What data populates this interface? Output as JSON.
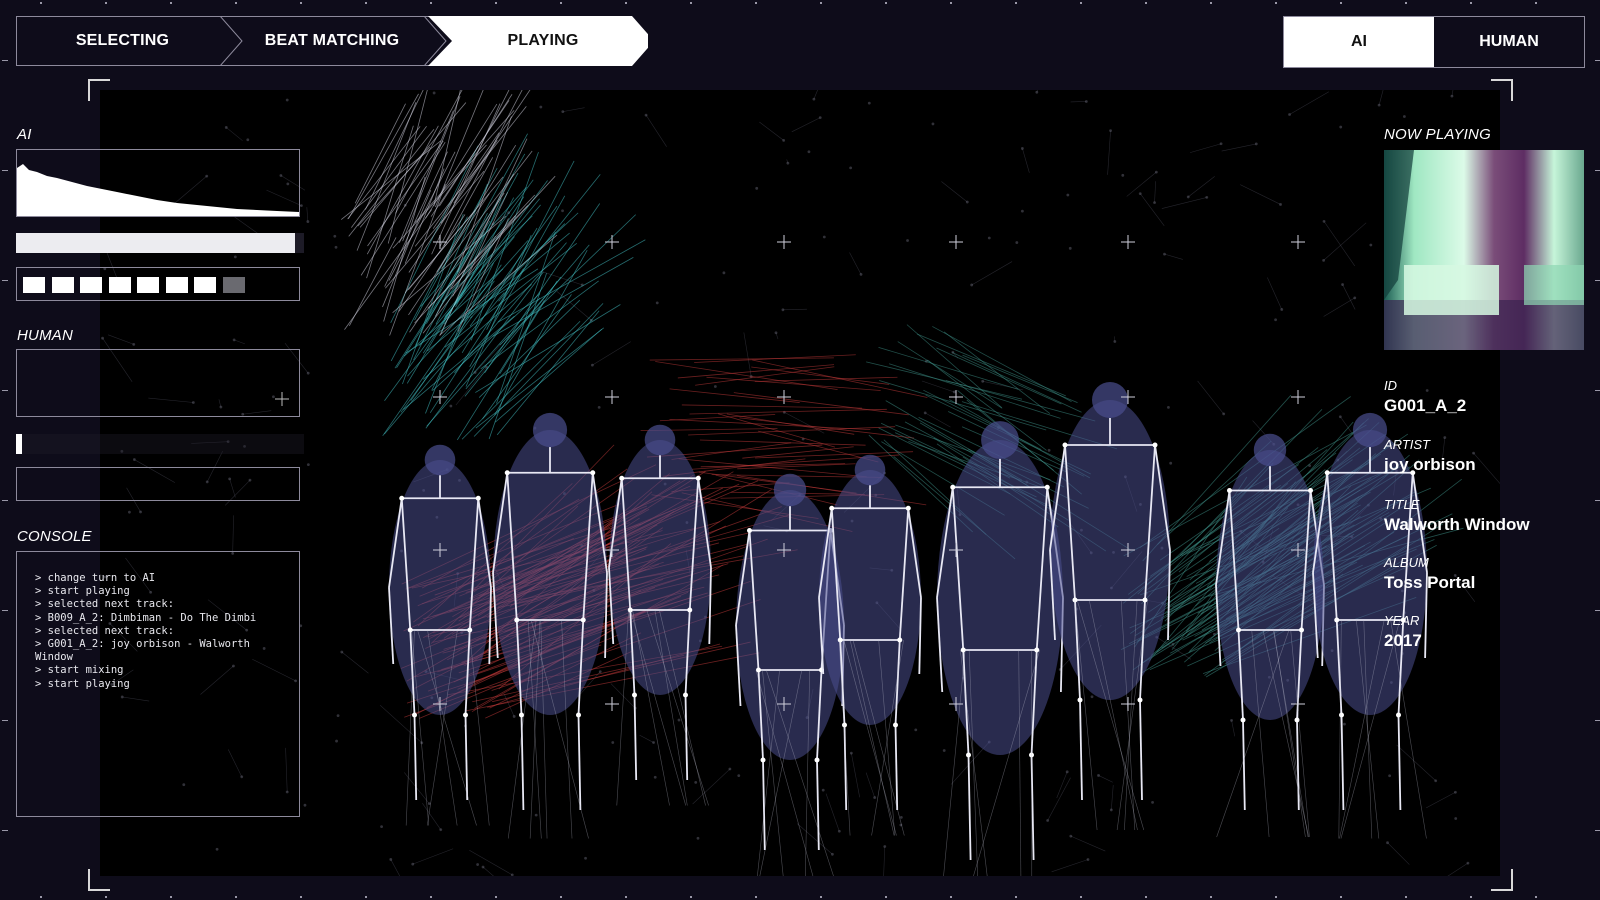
{
  "nav": {
    "steps": [
      {
        "label": "SELECTING",
        "active": false
      },
      {
        "label": "BEAT MATCHING",
        "active": false
      },
      {
        "label": "PLAYING",
        "active": true
      }
    ],
    "turn_toggle": {
      "options": [
        "AI",
        "HUMAN"
      ],
      "selected": "AI"
    }
  },
  "left_panel": {
    "ai": {
      "label": "AI",
      "progress_fraction": 0.97,
      "beat_indicators": {
        "total": 8,
        "active": 7
      }
    },
    "human": {
      "label": "HUMAN",
      "progress_fraction": 0.02
    },
    "console": {
      "label": "CONSOLE",
      "lines": [
        "> change turn to AI",
        "> start playing",
        "> selected next track:",
        "> B009_A_2: Dimbiman - Do The Dimbi",
        "> selected next track:",
        "> G001_A_2: joy orbison - Walworth Window",
        "> start mixing",
        "> start playing"
      ]
    }
  },
  "now_playing": {
    "label": "NOW PLAYING",
    "fields": [
      {
        "label": "ID",
        "value": "G001_A_2"
      },
      {
        "label": "ARTIST",
        "value": "joy orbison"
      },
      {
        "label": "TITLE",
        "value": "Walworth Window"
      },
      {
        "label": "ALBUM",
        "value": "Toss Portal"
      },
      {
        "label": "YEAR",
        "value": "2017"
      }
    ]
  },
  "colors": {
    "background": "#0e0c1a",
    "stage": "#000000",
    "border": "#8d8a9c",
    "skeleton_white": "#e8e8f4",
    "figure_blue": "#4a4f8e",
    "trail_red": "#c23a3a",
    "trail_cyan": "#44c4c8",
    "trail_teal": "#3d8f86",
    "art_green": "#a7f0c9",
    "art_purple": "#6a2a6e"
  }
}
